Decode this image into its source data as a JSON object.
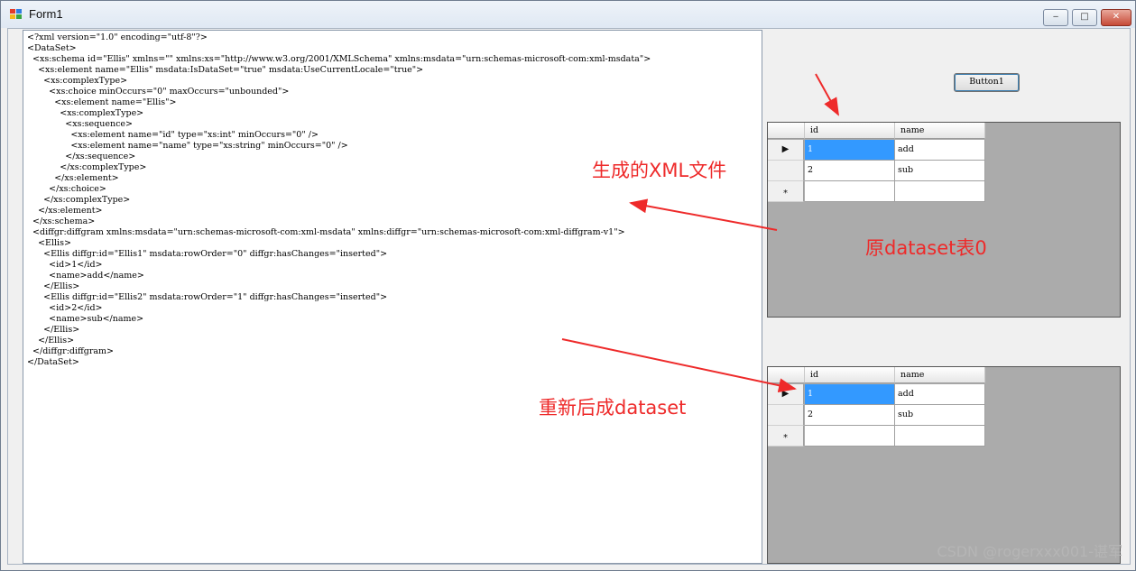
{
  "window": {
    "title": "Form1",
    "controls": {
      "minimize": "‒",
      "maximize": "□",
      "close": "✕"
    }
  },
  "xml_lines": [
    "<?xml version=\"1.0\" encoding=\"utf-8\"?>",
    "<DataSet>",
    "  <xs:schema id=\"Ellis\" xmlns=\"\" xmlns:xs=\"http://www.w3.org/2001/XMLSchema\" xmlns:msdata=\"urn:schemas-microsoft-com:xml-msdata\">",
    "    <xs:element name=\"Ellis\" msdata:IsDataSet=\"true\" msdata:UseCurrentLocale=\"true\">",
    "      <xs:complexType>",
    "        <xs:choice minOccurs=\"0\" maxOccurs=\"unbounded\">",
    "          <xs:element name=\"Ellis\">",
    "            <xs:complexType>",
    "              <xs:sequence>",
    "                <xs:element name=\"id\" type=\"xs:int\" minOccurs=\"0\" />",
    "                <xs:element name=\"name\" type=\"xs:string\" minOccurs=\"0\" />",
    "              </xs:sequence>",
    "            </xs:complexType>",
    "          </xs:element>",
    "        </xs:choice>",
    "      </xs:complexType>",
    "    </xs:element>",
    "  </xs:schema>",
    "  <diffgr:diffgram xmlns:msdata=\"urn:schemas-microsoft-com:xml-msdata\" xmlns:diffgr=\"urn:schemas-microsoft-com:xml-diffgram-v1\">",
    "    <Ellis>",
    "      <Ellis diffgr:id=\"Ellis1\" msdata:rowOrder=\"0\" diffgr:hasChanges=\"inserted\">",
    "        <id>1</id>",
    "        <name>add</name>",
    "      </Ellis>",
    "      <Ellis diffgr:id=\"Ellis2\" msdata:rowOrder=\"1\" diffgr:hasChanges=\"inserted\">",
    "        <id>2</id>",
    "        <name>sub</name>",
    "      </Ellis>",
    "    </Ellis>",
    "  </diffgr:diffgram>",
    "</DataSet>"
  ],
  "button1": {
    "label": "Button1"
  },
  "grids": [
    {
      "columns": [
        "id",
        "name"
      ],
      "rows": [
        {
          "marker": "▶",
          "cells": [
            "1",
            "add"
          ],
          "selected": true
        },
        {
          "marker": "",
          "cells": [
            "2",
            "sub"
          ],
          "selected": false
        },
        {
          "marker": "*",
          "cells": [
            "",
            ""
          ],
          "selected": false
        }
      ]
    },
    {
      "columns": [
        "id",
        "name"
      ],
      "rows": [
        {
          "marker": "▶",
          "cells": [
            "1",
            "add"
          ],
          "selected": true
        },
        {
          "marker": "",
          "cells": [
            "2",
            "sub"
          ],
          "selected": false
        },
        {
          "marker": "*",
          "cells": [
            "",
            ""
          ],
          "selected": false
        }
      ]
    }
  ],
  "annotations": {
    "xml_file": "生成的XML文件",
    "original_table": "原dataset表0",
    "regenerated": "重新后成dataset",
    "color": "#ee2a2a"
  },
  "watermark": "CSDN @rogerxxx001-谌军"
}
